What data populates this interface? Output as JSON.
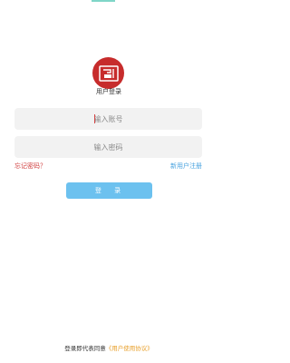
{
  "title": "用户登录",
  "fields": {
    "account_placeholder": "输入账号",
    "password_placeholder": "输入密码"
  },
  "links": {
    "forgot_password": "忘记密码？",
    "register": "新用户注册"
  },
  "login_button": "登  录",
  "agreement": {
    "prefix": "登录即代表同意",
    "link": "《用户使用协议》"
  },
  "colors": {
    "brand_red": "#c72c2c",
    "accent_blue": "#6cc1ef",
    "link_blue": "#4aa3df",
    "link_orange": "#e8a02c"
  },
  "icons": {
    "logo": "mobile-crane-icon"
  }
}
